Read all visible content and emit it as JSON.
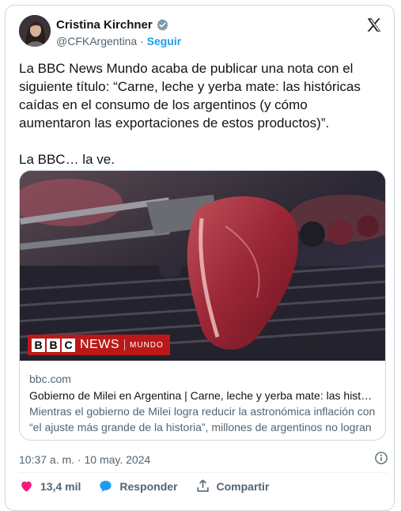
{
  "author": {
    "name": "Cristina Kirchner",
    "handle": "@CFKArgentina",
    "separator": "·",
    "follow_label": "Seguir"
  },
  "tweet": {
    "text": "La BBC News Mundo acaba de publicar una nota con el siguiente título: “Carne, leche y yerba mate: las históricas caídas en el consumo de los argentinos (y cómo aumentaron las exportaciones de estos productos)”.\n\nLa BBC… la ve."
  },
  "link_card": {
    "brand_blocks": [
      "B",
      "B",
      "C"
    ],
    "brand_news": "NEWS",
    "brand_mundo": "MUNDO",
    "domain": "bbc.com",
    "title": "Gobierno de Milei en Argentina | Carne, leche y yerba mate: las histórica…",
    "description": "Mientras el gobierno de Milei logra reducir la astronómica inflación con “el ajuste más grande de la historia”, millones de argentinos no logran …"
  },
  "meta": {
    "timestamp": "10:37 a. m. · 10 may. 2024"
  },
  "actions": {
    "likes": "13,4 mil",
    "reply_label": "Responder",
    "share_label": "Compartir"
  },
  "colors": {
    "accent": "#1d9bf0",
    "like": "#f91880",
    "bbc_red": "#bb1919"
  },
  "icons": [
    "verified-icon",
    "x-logo-icon",
    "info-icon",
    "heart-icon",
    "reply-icon",
    "share-icon"
  ]
}
